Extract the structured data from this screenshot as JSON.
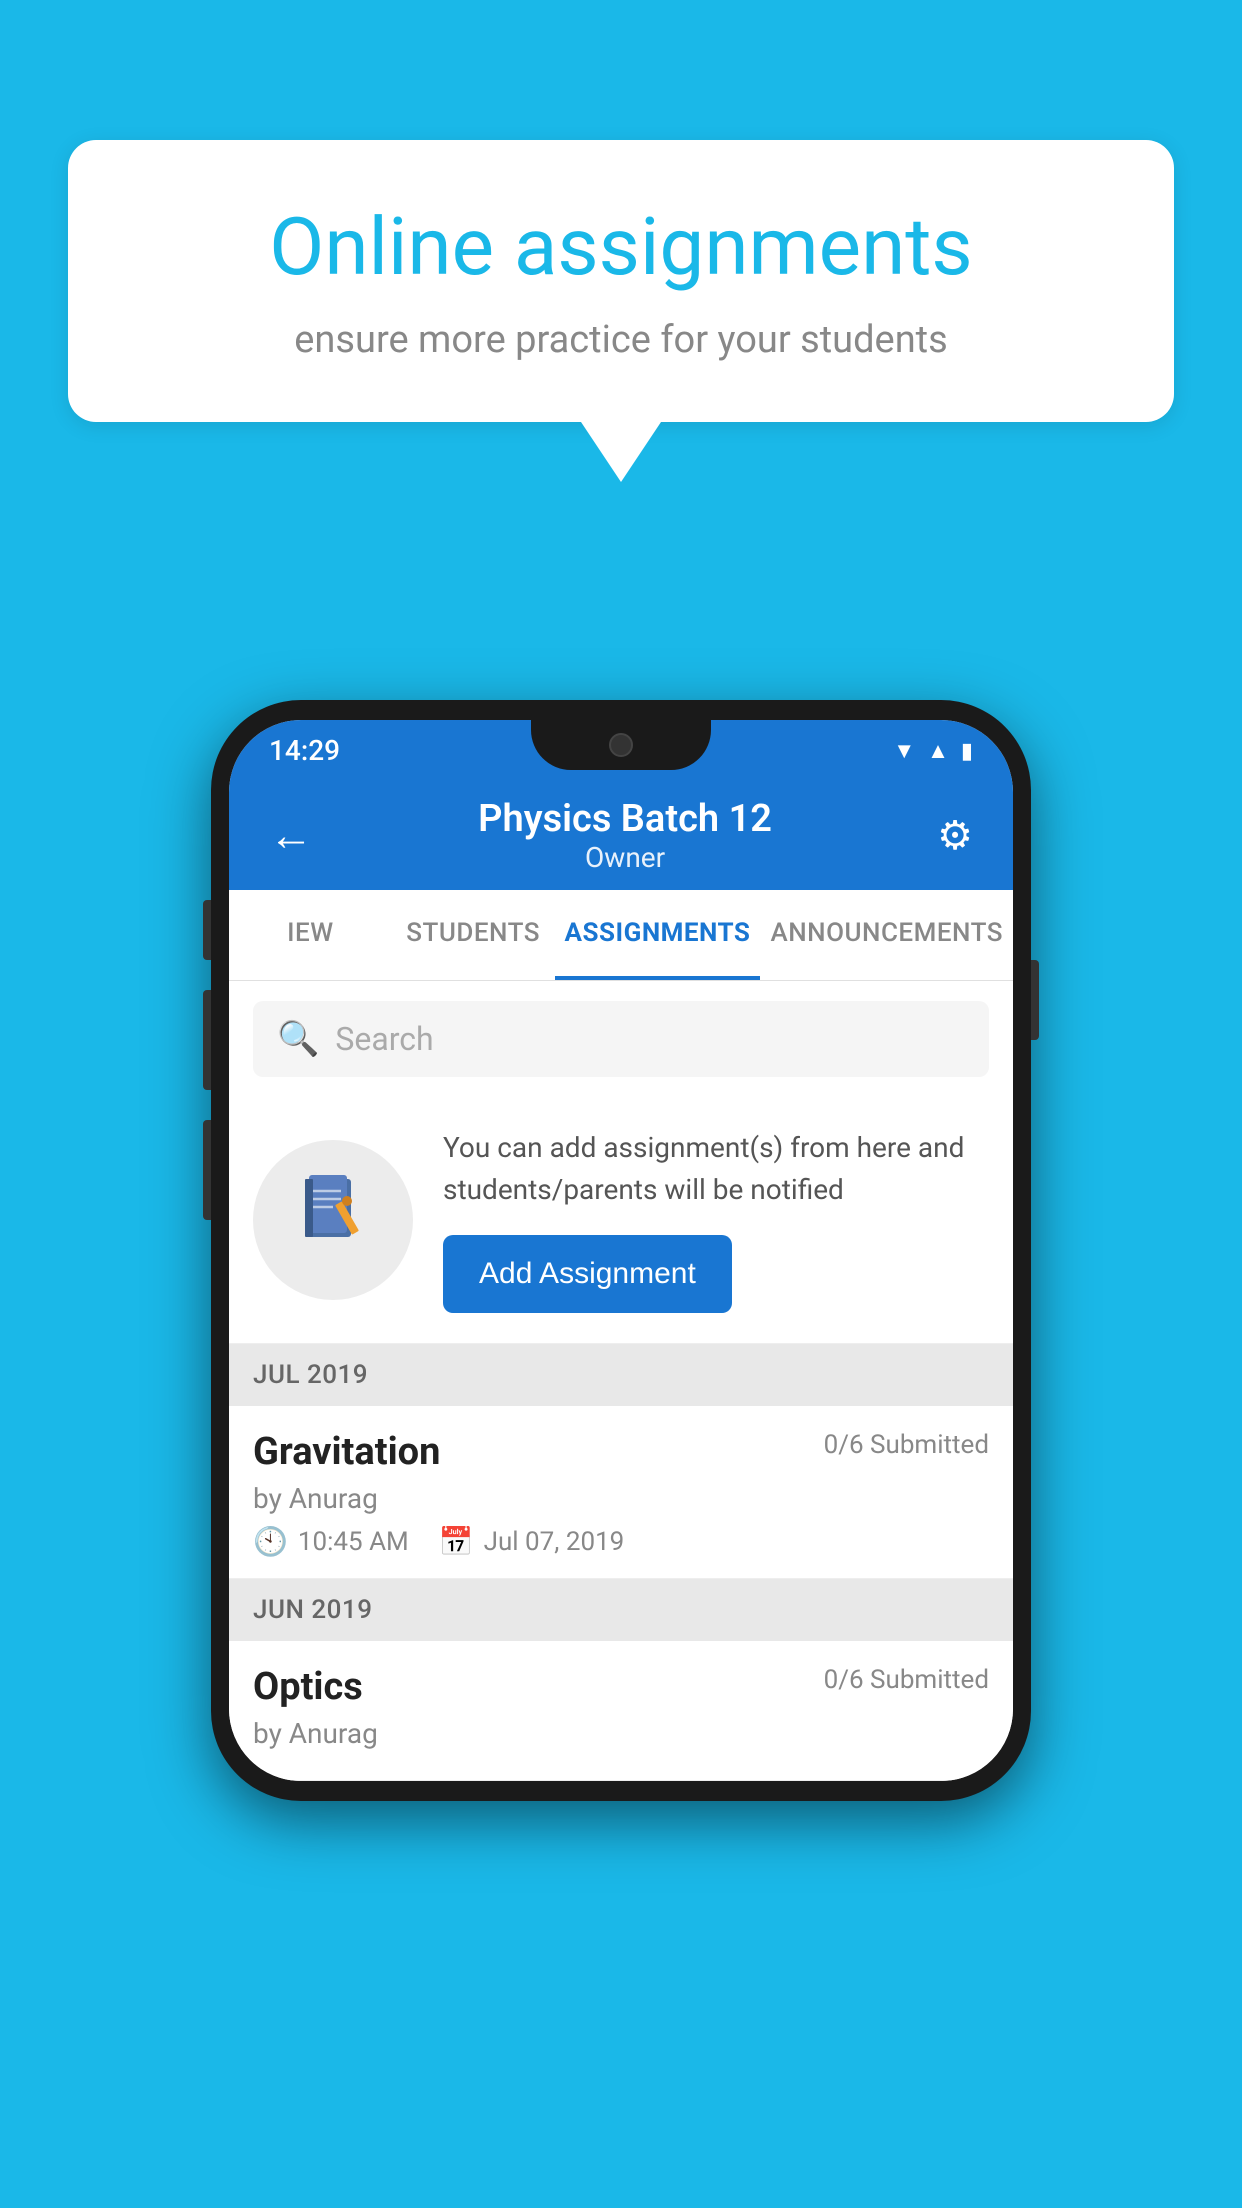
{
  "background_color": "#1ab8e8",
  "speech_bubble": {
    "title": "Online assignments",
    "subtitle": "ensure more practice for your students"
  },
  "status_bar": {
    "time": "14:29",
    "wifi_icon": "wifi-icon",
    "signal_icon": "signal-icon",
    "battery_icon": "battery-icon"
  },
  "app_bar": {
    "title": "Physics Batch 12",
    "subtitle": "Owner",
    "back_label": "←",
    "settings_label": "⚙"
  },
  "tabs": [
    {
      "label": "IEW",
      "active": false
    },
    {
      "label": "STUDENTS",
      "active": false
    },
    {
      "label": "ASSIGNMENTS",
      "active": true
    },
    {
      "label": "ANNOUNCEMENTS",
      "active": false
    }
  ],
  "search": {
    "placeholder": "Search"
  },
  "promo": {
    "icon": "📓",
    "text": "You can add assignment(s) from here and students/parents will be notified",
    "button_label": "Add Assignment"
  },
  "sections": [
    {
      "month": "JUL 2019",
      "assignments": [
        {
          "title": "Gravitation",
          "submitted": "0/6 Submitted",
          "by": "by Anurag",
          "time": "10:45 AM",
          "date": "Jul 07, 2019"
        }
      ]
    },
    {
      "month": "JUN 2019",
      "assignments": [
        {
          "title": "Optics",
          "submitted": "0/6 Submitted",
          "by": "by Anurag",
          "time": "",
          "date": ""
        }
      ]
    }
  ]
}
